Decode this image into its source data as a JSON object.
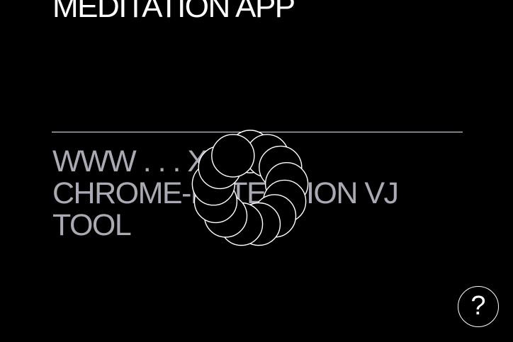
{
  "page": {
    "headline": "MEDITATION APP",
    "body_lines": [
      "WWW . . . XYZ",
      "CHROME-EXTENSION VJ",
      "TOOL"
    ],
    "help_label": "?"
  },
  "colors": {
    "background": "#000000",
    "headline": "#ffffff",
    "body_text": "#a9aab3",
    "circle_stroke": "#ffffff",
    "divider": "#e8e8f0"
  },
  "icons": {
    "help": "question-mark-icon",
    "visual": "circle-ring-icon"
  }
}
